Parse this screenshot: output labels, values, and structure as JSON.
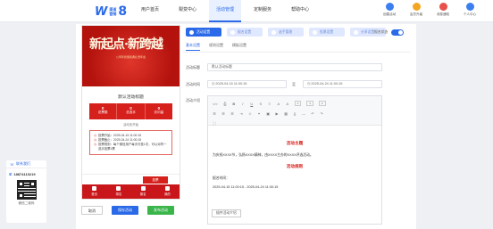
{
  "header": {
    "logo_small_line1": "渠道",
    "logo_small_line2": "营销",
    "logo_num": "8",
    "nav": [
      "用户首页",
      "裂变中心",
      "活动管理",
      "定制服务",
      "帮助中心"
    ],
    "tools": [
      {
        "label": "创建活动",
        "color": "#3b7ef0",
        "icon": "plus-doc-icon"
      },
      {
        "label": "会员升级",
        "color": "#f4a623",
        "icon": "crown-icon"
      },
      {
        "label": "消息通知",
        "color": "#e8504a",
        "icon": "bell-icon"
      },
      {
        "label": "个人中心",
        "color": "#3b7ef0",
        "icon": "user-icon"
      }
    ]
  },
  "contact": {
    "title": "联系我们",
    "phone": "18874110219",
    "caption": "微信二维码"
  },
  "preview": {
    "banner_title": "新起点·新跨越",
    "banner_sub": "公司年终颁奖典礼暨年会",
    "title": "默认活动标题",
    "counts": [
      {
        "n": "0",
        "label": "总票数"
      },
      {
        "n": "0",
        "label": "总选手"
      },
      {
        "n": "0",
        "label": "访问量"
      }
    ],
    "sub": "活动未开始",
    "info": [
      "投票开始：2025-04-15 11:00:15",
      "投票截止：2025-04-24 11:00:15",
      "投票规则：每个微信用户每天可投1次，可以对同一选手投票1票"
    ],
    "vote_btn": "投票",
    "tabs": [
      "首页",
      "排名",
      "报名",
      "我的"
    ]
  },
  "actions": {
    "back": "取消",
    "save": "保存活动",
    "publish": "发布活动"
  },
  "steps": [
    "活动设置",
    "报名设置",
    "选手管理",
    "投票设置",
    "分享设置"
  ],
  "toggle_label": "报名状态",
  "subtabs": [
    "基本设置",
    "规则设置",
    "模板设置"
  ],
  "form": {
    "title_label": "活动标题",
    "title_value": "默认活动标题",
    "time_label": "活动时间",
    "start": "2025-04-15 11:00:15",
    "to": "至",
    "end": "2025-04-24 11:00:15",
    "intro_label": "活动介绍",
    "format_btn": "插件活动介绍"
  },
  "editor": {
    "heading1": "活动主题",
    "para1": "为庆祝XXXX节，弘扬XXXX精神，由XXXX主办的XXXX评选活动。",
    "heading2": "活动规则",
    "para2": "报名时间：",
    "para3": "2025-04-15 11:00:15 - 2025-04-24 11:00:15"
  }
}
